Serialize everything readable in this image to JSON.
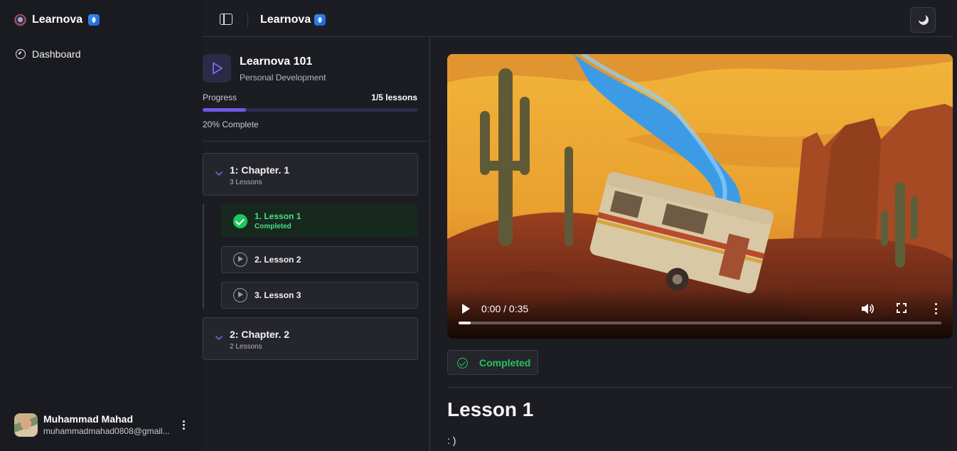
{
  "sidebar": {
    "brand": "Learnova",
    "nav": [
      {
        "label": "Dashboard",
        "icon": "compass-icon"
      }
    ],
    "user": {
      "name": "Muhammad Mahad",
      "email": "muhammadmahad0808@gmail..."
    }
  },
  "header": {
    "title": "Learnova"
  },
  "course": {
    "title": "Learnova 101",
    "category": "Personal Development",
    "progress_label": "Progress",
    "progress_count": "1/5 lessons",
    "progress_fraction": 0.2,
    "progress_text": "20% Complete",
    "chapters": [
      {
        "title": "1: Chapter. 1",
        "count": "3 Lessons",
        "lessons": [
          {
            "title": "1. Lesson 1",
            "status": "Completed"
          },
          {
            "title": "2. Lesson 2"
          },
          {
            "title": "3. Lesson 3"
          }
        ]
      },
      {
        "title": "2: Chapter. 2",
        "count": "2 Lessons"
      }
    ]
  },
  "video": {
    "time": "0:00 / 0:35",
    "played_fraction": 0.025
  },
  "lesson": {
    "status_button": "Completed",
    "title": "Lesson 1",
    "body": ": )"
  },
  "colors": {
    "accent": "#7057e8",
    "success": "#22c55e",
    "background": "#1c1d22"
  }
}
